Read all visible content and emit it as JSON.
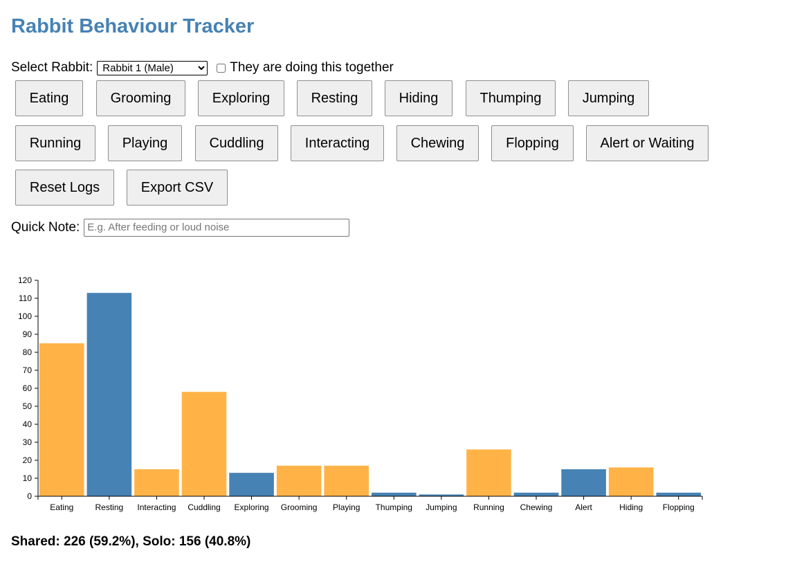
{
  "title": "Rabbit Behaviour Tracker",
  "controls": {
    "select_label": "Select Rabbit:",
    "rabbit_options": [
      "Rabbit 1 (Male)"
    ],
    "selected_rabbit": "Rabbit 1 (Male)",
    "together_label": "They are doing this together",
    "together_checked": false
  },
  "buttons": {
    "row1": [
      "Eating",
      "Grooming",
      "Exploring",
      "Resting",
      "Hiding",
      "Thumping",
      "Jumping"
    ],
    "row2": [
      "Running",
      "Playing",
      "Cuddling",
      "Interacting",
      "Chewing",
      "Flopping",
      "Alert or Waiting"
    ],
    "row3": [
      "Reset Logs",
      "Export CSV"
    ]
  },
  "note": {
    "label": "Quick Note:",
    "placeholder": "E.g. After feeding or loud noise",
    "value": ""
  },
  "colors": {
    "title": "#4682b4",
    "shared_bar": "#ffb347",
    "solo_bar": "#4682b4"
  },
  "chart_data": {
    "type": "bar",
    "categories": [
      "Eating",
      "Resting",
      "Interacting",
      "Cuddling",
      "Exploring",
      "Grooming",
      "Playing",
      "Thumping",
      "Jumping",
      "Running",
      "Chewing",
      "Alert",
      "Hiding",
      "Flopping"
    ],
    "values": [
      85,
      113,
      15,
      58,
      13,
      17,
      17,
      2,
      1,
      26,
      2,
      15,
      16,
      2
    ],
    "bar_colors": [
      "#ffb347",
      "#4682b4",
      "#ffb347",
      "#ffb347",
      "#4682b4",
      "#ffb347",
      "#ffb347",
      "#4682b4",
      "#4682b4",
      "#ffb347",
      "#4682b4",
      "#4682b4",
      "#ffb347",
      "#4682b4"
    ],
    "yticks": [
      0,
      10,
      20,
      30,
      40,
      50,
      60,
      70,
      80,
      90,
      100,
      110,
      120
    ],
    "ylim": [
      0,
      120
    ],
    "title": "",
    "xlabel": "",
    "ylabel": "",
    "grid": false,
    "legend": "none"
  },
  "summary": "Shared: 226 (59.2%), Solo: 156 (40.8%)"
}
